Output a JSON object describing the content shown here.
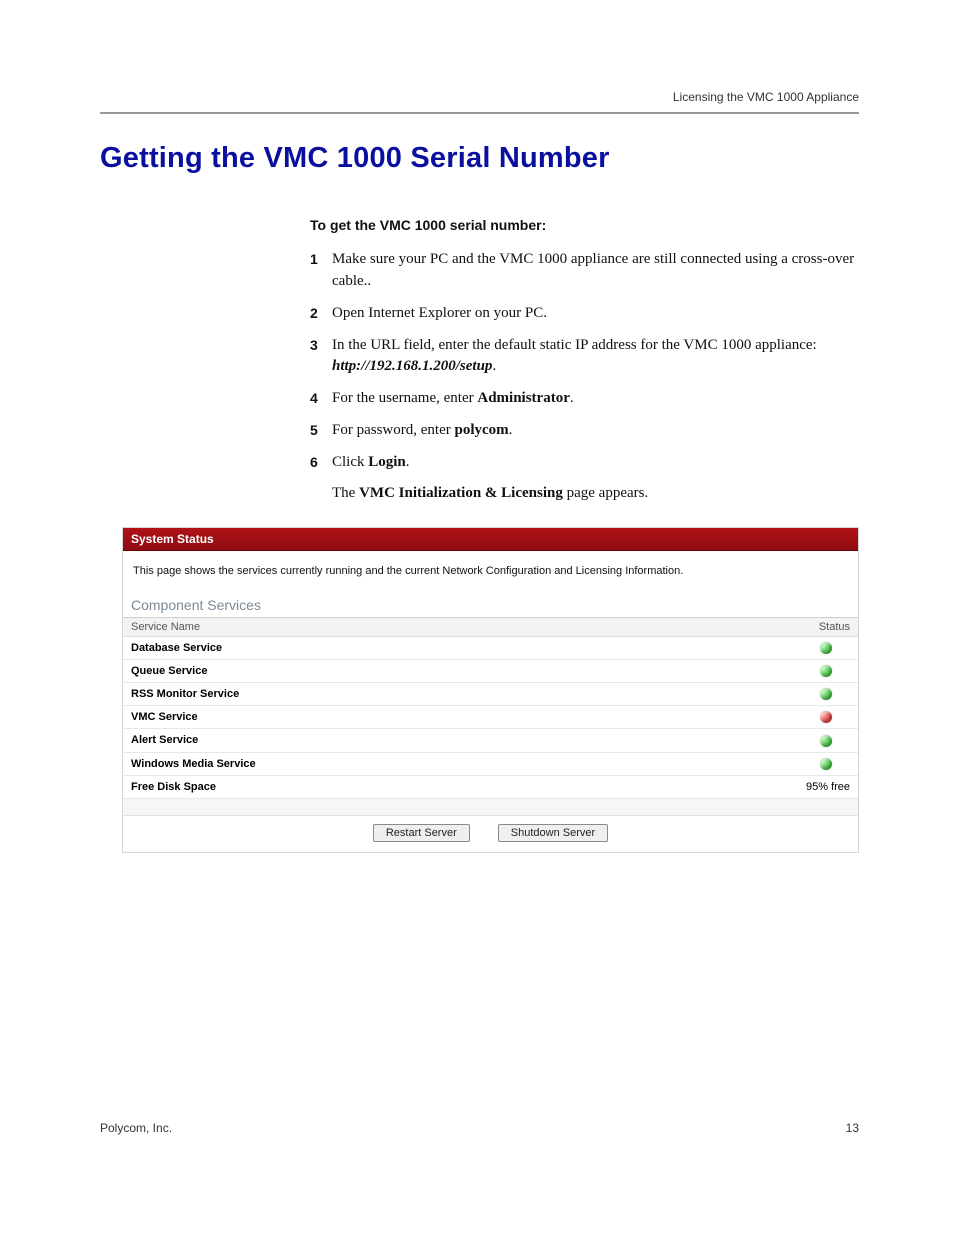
{
  "header": {
    "running_head": "Licensing the VMC 1000 Appliance"
  },
  "title": "Getting the VMC 1000 Serial Number",
  "subhead": "To get the VMC 1000 serial number:",
  "steps": [
    {
      "n": "1",
      "text": "Make sure your PC and the VMC 1000 appliance are still connected using a cross-over cable.."
    },
    {
      "n": "2",
      "text": "Open Internet Explorer on your PC."
    },
    {
      "n": "3",
      "pre": "In the URL field, enter the default static IP address for the VMC 1000 appliance: ",
      "emph": "http://192.168.1.200/setup",
      "post": "."
    },
    {
      "n": "4",
      "pre": "For the username, enter ",
      "bold": "Administrator",
      "post": "."
    },
    {
      "n": "5",
      "pre": "For password, enter ",
      "bold": "polycom",
      "post": "."
    },
    {
      "n": "6",
      "pre": "Click ",
      "bold": "Login",
      "post": ".",
      "follow_pre": "The ",
      "follow_bold": "VMC Initialization & Licensing",
      "follow_post": " page appears."
    }
  ],
  "screenshot": {
    "panel_title": "System Status",
    "description": "This page shows the services currently running and the current Network Configuration and Licensing Information.",
    "section": "Component Services",
    "col_name": "Service Name",
    "col_status": "Status",
    "rows": [
      {
        "name": "Database Service",
        "status": "green"
      },
      {
        "name": "Queue Service",
        "status": "green"
      },
      {
        "name": "RSS Monitor Service",
        "status": "green"
      },
      {
        "name": "VMC Service",
        "status": "red"
      },
      {
        "name": "Alert Service",
        "status": "green"
      },
      {
        "name": "Windows Media Service",
        "status": "green"
      },
      {
        "name": "Free Disk Space",
        "status_text": "95% free"
      }
    ],
    "btn_restart": "Restart Server",
    "btn_shutdown": "Shutdown Server"
  },
  "footer": {
    "left": "Polycom, Inc.",
    "right": "13"
  }
}
